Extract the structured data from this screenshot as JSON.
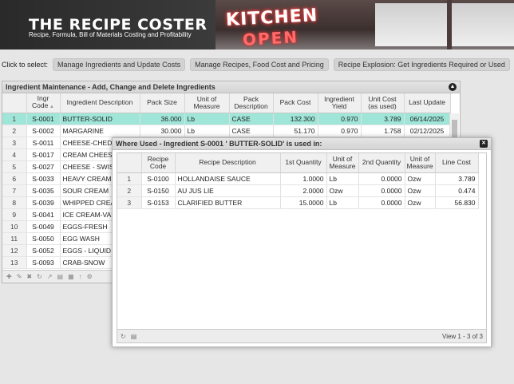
{
  "header": {
    "title": "THE RECIPE COSTER",
    "subtitle": "Recipe, Formula, Bill of Materials Costing and Profitability",
    "sign_top": "KITCHEN",
    "sign_bottom": "OPEN"
  },
  "nav": {
    "label": "Click to select:",
    "buttons": [
      "Manage Ingredients and Update Costs",
      "Manage Recipes, Food Cost and Pricing",
      "Recipe Explosion: Get Ingredients Required or Used"
    ]
  },
  "ingredients": {
    "title": "Ingredient Maintenance - Add, Change and Delete Ingredients",
    "columns": [
      "",
      "Ingr Code",
      "Ingredient Description",
      "Pack Size",
      "Unit of Measure",
      "Pack Description",
      "Pack Cost",
      "Ingredient Yield",
      "Unit Cost (as used)",
      "Last Update"
    ],
    "rows": [
      [
        "1",
        "S-0001",
        "BUTTER-SOLID",
        "36.000",
        "Lb",
        "CASE",
        "132.300",
        "0.970",
        "3.789",
        "06/14/2025"
      ],
      [
        "2",
        "S-0002",
        "MARGARINE",
        "30.000",
        "Lb",
        "CASE",
        "51.170",
        "0.970",
        "1.758",
        "02/12/2025"
      ],
      [
        "3",
        "S-0011",
        "CHEESE-CHEDDAR",
        "",
        "",
        "",
        "",
        "",
        "",
        ""
      ],
      [
        "4",
        "S-0017",
        "CREAM CHEESE",
        "",
        "",
        "",
        "",
        "",
        "",
        ""
      ],
      [
        "5",
        "S-0027",
        "CHEESE - SWISS",
        "",
        "",
        "",
        "",
        "",
        "",
        ""
      ],
      [
        "6",
        "S-0033",
        "HEAVY CREAM",
        "",
        "",
        "",
        "",
        "",
        "",
        ""
      ],
      [
        "7",
        "S-0035",
        "SOUR CREAM",
        "",
        "",
        "",
        "",
        "",
        "",
        ""
      ],
      [
        "8",
        "S-0039",
        "WHIPPED CREAM",
        "",
        "",
        "",
        "",
        "",
        "",
        ""
      ],
      [
        "9",
        "S-0041",
        "ICE CREAM-VANILLA",
        "",
        "",
        "",
        "",
        "",
        "",
        ""
      ],
      [
        "10",
        "S-0049",
        "EGGS-FRESH",
        "",
        "",
        "",
        "",
        "",
        "",
        ""
      ],
      [
        "11",
        "S-0050",
        "EGG WASH",
        "",
        "",
        "",
        "",
        "",
        "",
        ""
      ],
      [
        "12",
        "S-0052",
        "EGGS - LIQUID",
        "",
        "",
        "",
        "",
        "",
        "",
        ""
      ],
      [
        "13",
        "S-0093",
        "CRAB-SNOW",
        "",
        "",
        "",
        "",
        "",
        "",
        ""
      ]
    ]
  },
  "where_used": {
    "title": "Where Used - Ingredient S-0001 ' BUTTER-SOLID' is used in:",
    "columns": [
      "",
      "Recipe Code",
      "Recipe Description",
      "1st Quantity",
      "Unit of Measure",
      "2nd Quantity",
      "Unit of Measure",
      "Line Cost"
    ],
    "rows": [
      [
        "1",
        "S-0100",
        "HOLLANDAISE SAUCE",
        "1.0000",
        "Lb",
        "0.0000",
        "Ozw",
        "3.789"
      ],
      [
        "2",
        "S-0150",
        "AU JUS LIE",
        "2.0000",
        "Ozw",
        "0.0000",
        "Ozw",
        "0.474"
      ],
      [
        "3",
        "S-0153",
        "CLARIFIED BUTTER",
        "15.0000",
        "Lb",
        "0.0000",
        "Ozw",
        "56.830"
      ]
    ],
    "footer": "View 1 - 3 of 3"
  }
}
